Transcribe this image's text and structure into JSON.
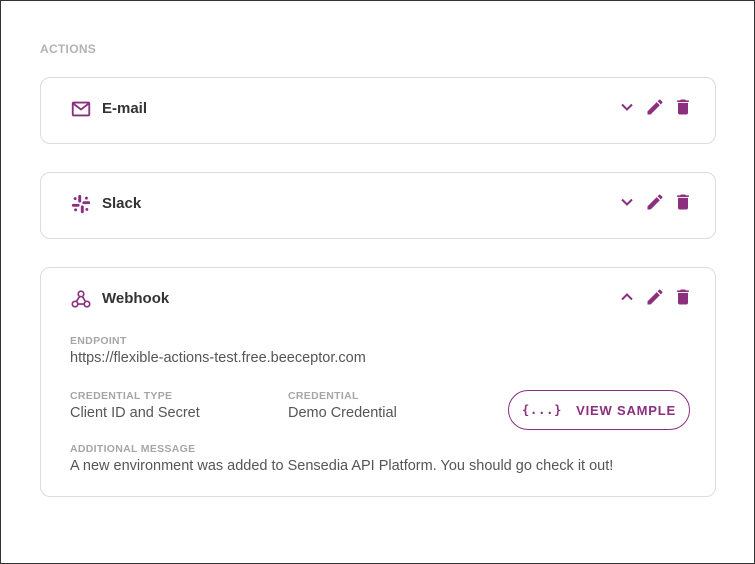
{
  "section": {
    "title": "ACTIONS"
  },
  "colors": {
    "accent": "#8b2f7f",
    "label": "#a6a6a6",
    "text": "#555555",
    "border": "#dcdcdc"
  },
  "actions": [
    {
      "name": "E-mail",
      "icon": "envelope-icon",
      "expanded": false
    },
    {
      "name": "Slack",
      "icon": "slack-icon",
      "expanded": false
    },
    {
      "name": "Webhook",
      "icon": "webhook-icon",
      "expanded": true
    }
  ],
  "webhook": {
    "endpoint_label": "ENDPOINT",
    "endpoint_value": "https://flexible-actions-test.free.beeceptor.com",
    "credential_type_label": "CREDENTIAL TYPE",
    "credential_type_value": "Client ID and Secret",
    "credential_label": "CREDENTIAL",
    "credential_value": "Demo Credential",
    "view_sample_label": "VIEW SAMPLE",
    "view_sample_icon": "{...}",
    "message_label": "ADDITIONAL MESSAGE",
    "message_value": "A new environment was added to Sensedia API Platform. You should go check it out!"
  }
}
